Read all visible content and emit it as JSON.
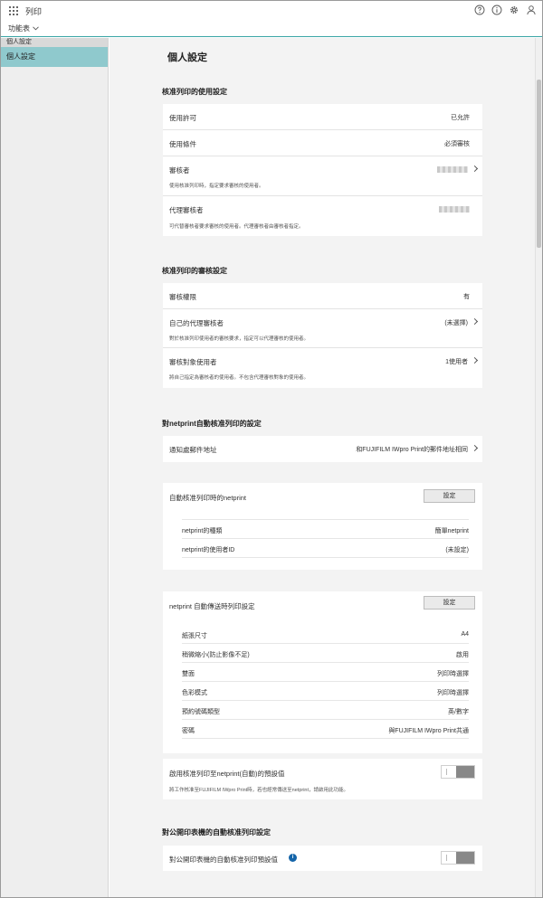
{
  "app": {
    "title": "列印",
    "menu_label": "功能表"
  },
  "top_icons": [
    "help-icon",
    "info-icon",
    "gear-icon",
    "user-icon"
  ],
  "sidebar": {
    "header": "個人設定",
    "items": [
      {
        "label": "個人設定"
      }
    ]
  },
  "page": {
    "title": "個人設定"
  },
  "approval_usage": {
    "title": "核准列印的使用設定",
    "permission": {
      "label": "使用許可",
      "value": "已允許"
    },
    "conditions": {
      "label": "使用條件",
      "value": "必須審核"
    },
    "approver": {
      "label": "審核者",
      "desc": "使用核准列印時，指定要求審核的使用者。"
    },
    "proxy_approver": {
      "label": "代理審核者",
      "desc": "可代替審核者要求審核的使用者。代理審核者由審核者指定。"
    }
  },
  "approval_review": {
    "title": "核准列印的審核設定",
    "authority": {
      "label": "審核權限",
      "value": "有"
    },
    "own_proxy": {
      "label": "自己的代理審核者",
      "value": "(未選擇)",
      "desc": "對於核准列印使用者的審核要求，指定可以代理審核的使用者。"
    },
    "target_users": {
      "label": "審核對象使用者",
      "value": "1使用者",
      "desc": "將自己指定為審核者的使用者。不包含代理審核對象的使用者。"
    }
  },
  "netprint_auto": {
    "title": "對netprint自動核准列印的設定",
    "notify_email": {
      "label": "通知處郵件地址",
      "value": "和FUJIFILM IWpro Print的郵件地址相同"
    },
    "auto_netprint": {
      "label": "自動核准列印時的netprint",
      "button": "設定",
      "rows": [
        {
          "label": "netprint的種類",
          "value": "簡單netprint"
        },
        {
          "label": "netprint的使用者ID",
          "value": "(未設定)"
        }
      ]
    },
    "auto_send": {
      "label": "netprint 自動傳送時列印設定",
      "button": "設定",
      "rows": [
        {
          "label": "紙張尺寸",
          "value": "A4"
        },
        {
          "label": "稍微縮小(防止影像不足)",
          "value": "啟用"
        },
        {
          "label": "雙面",
          "value": "列印時選擇"
        },
        {
          "label": "色彩模式",
          "value": "列印時選擇"
        },
        {
          "label": "預約號碼類型",
          "value": "英/數字"
        },
        {
          "label": "密碼",
          "value": "與FUJIFILM IWpro Print共通"
        }
      ]
    },
    "enable_default": {
      "label": "啟用核准列印至netprint(自動)的預設值",
      "desc": "將工作核准至FUJIFILM IWpro Print時，若也經常傳送至netprint，請啟用此功能。"
    }
  },
  "public_printer": {
    "title": "對公開印表機的自動核准列印設定",
    "default": {
      "label": "對公開印表機的自動核准列印預設值"
    }
  }
}
